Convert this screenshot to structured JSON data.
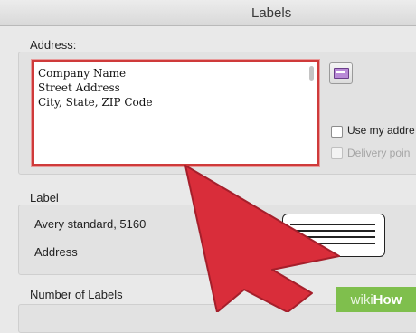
{
  "window": {
    "title": "Labels"
  },
  "address": {
    "section_label": "Address:",
    "lines": [
      "Company Name",
      "Street Address",
      "City, State, ZIP Code"
    ],
    "contact_icon": "address-card-icon",
    "use_my_address_label": "Use my addre",
    "delivery_point_label": "Delivery poin",
    "use_my_address_checked": false,
    "delivery_point_enabled": false
  },
  "label": {
    "section_label": "Label",
    "product": "Avery standard, 5160",
    "type": "Address",
    "preview_icon": "label-preview-icon"
  },
  "number_of_labels": {
    "section_label": "Number of Labels"
  },
  "overlay": {
    "arrow_color": "#d92d3a",
    "watermark_prefix": "wiki",
    "watermark_suffix": "How",
    "watermark_bg": "#7fbf4d"
  },
  "colors": {
    "focus_ring": "#cf3a3a"
  }
}
